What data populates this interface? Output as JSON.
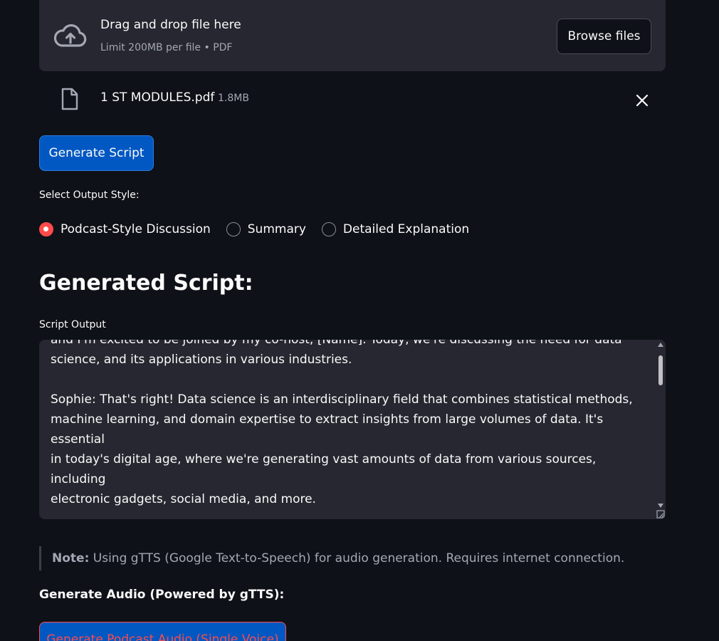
{
  "uploader": {
    "title": "Drag and drop file here",
    "limit": "Limit 200MB per file • PDF",
    "browse_label": "Browse files"
  },
  "uploaded_file": {
    "name": "1 ST MODULES.pdf",
    "size": "1.8MB"
  },
  "generate_button": "Generate Script",
  "output_style": {
    "label": "Select Output Style:",
    "options": [
      {
        "label": "Podcast-Style Discussion",
        "selected": true
      },
      {
        "label": "Summary",
        "selected": false
      },
      {
        "label": "Detailed Explanation",
        "selected": false
      }
    ]
  },
  "generated_heading": "Generated Script:",
  "script_output": {
    "label": "Script Output",
    "text": "and I'm excited to be joined by my co-host, [Name]. Today, we're discussing the need for data\nscience, and its applications in various industries.\n\nSophie: That's right! Data science is an interdisciplinary field that combines statistical methods,\nmachine learning, and domain expertise to extract insights from large volumes of data. It's essential\nin today's digital age, where we're generating vast amounts of data from various sources, including\nelectronic gadgets, social media, and more.\n\nAlice: Exactly! And one of the key aspects of data science is its ability to help businesses understand"
  },
  "note": {
    "bold": "Note:",
    "text": " Using gTTS (Google Text-to-Speech) for audio generation. Requires internet connection."
  },
  "audio": {
    "label": "Generate Audio (Powered by gTTS):",
    "button": "Generate Podcast Audio (Single Voice)"
  }
}
